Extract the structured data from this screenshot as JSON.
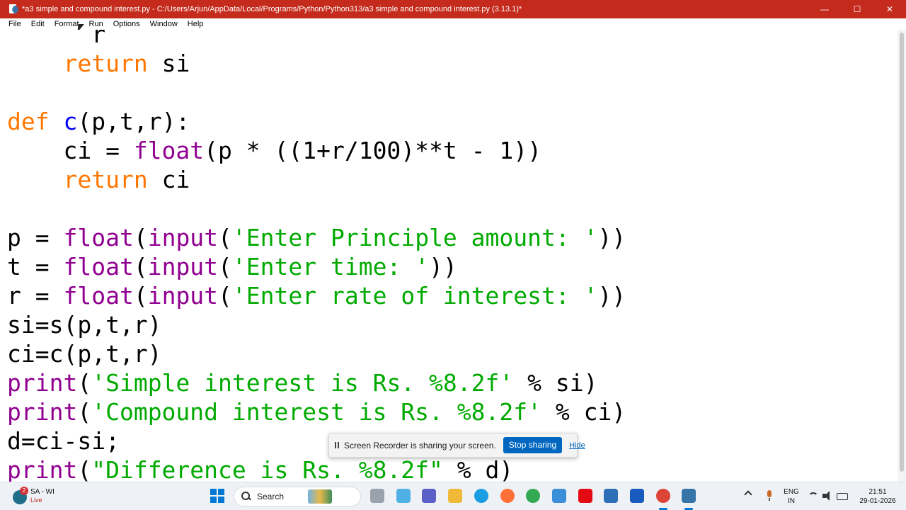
{
  "window": {
    "title": "*a3 simple and compound interest.py - C:/Users/Arjun/AppData/Local/Programs/Python/Python313/a3 simple and compound interest.py (3.13.1)*",
    "controls": {
      "minimize": "—",
      "maximize": "☐",
      "close": "✕"
    },
    "titlebar_color": "#c42b1c"
  },
  "menu": {
    "items": [
      "File",
      "Edit",
      "Format",
      "Run",
      "Options",
      "Window",
      "Help"
    ]
  },
  "editor": {
    "colors": {
      "keyword": "#ff7700",
      "definition": "#0000ff",
      "builtin": "#900090",
      "string": "#00aa00",
      "default": "#000000"
    },
    "lines": [
      {
        "kind": "partial",
        "text": "      r"
      },
      {
        "kind": "code",
        "text": "    return si"
      },
      {
        "kind": "blank",
        "text": ""
      },
      {
        "kind": "code",
        "text": "def c(p,t,r):"
      },
      {
        "kind": "code",
        "text": "    ci = float(p * ((1+r/100)**t - 1))"
      },
      {
        "kind": "code",
        "text": "    return ci"
      },
      {
        "kind": "blank",
        "text": ""
      },
      {
        "kind": "code",
        "text": "p = float(input('Enter Principle amount: '))"
      },
      {
        "kind": "code",
        "text": "t = float(input('Enter time: '))"
      },
      {
        "kind": "code",
        "text": "r = float(input('Enter rate of interest: '))"
      },
      {
        "kind": "code",
        "text": "si=s(p,t,r)"
      },
      {
        "kind": "code",
        "text": "ci=c(p,t,r)"
      },
      {
        "kind": "code",
        "text": "print('Simple interest is Rs. %8.2f' % si)"
      },
      {
        "kind": "code",
        "text": "print('Compound interest is Rs. %8.2f' % ci)"
      },
      {
        "kind": "code",
        "text": "d=ci-si;"
      },
      {
        "kind": "code",
        "text": "print(\"Difference is Rs. %8.2f\" % d)"
      }
    ]
  },
  "screen_share_toast": {
    "message": "Screen Recorder is sharing your screen.",
    "stop_label": "Stop sharing",
    "hide_label": "Hide"
  },
  "taskbar": {
    "weather": {
      "badge": "2",
      "title": "SA - WI",
      "subtitle": "Live"
    },
    "search_label": "Search",
    "apps": [
      {
        "name": "task-view",
        "color": "#9aa3ad"
      },
      {
        "name": "copilot",
        "color": "#4fb0e6"
      },
      {
        "name": "teams",
        "color": "#5b5fc7"
      },
      {
        "name": "file-explorer",
        "color": "#f0b93a"
      },
      {
        "name": "edge",
        "color": "#1b9de2"
      },
      {
        "name": "firefox",
        "color": "#ff7139"
      },
      {
        "name": "chrome",
        "color": "#34a853"
      },
      {
        "name": "microsoft-store",
        "color": "#3b8ed8"
      },
      {
        "name": "netflix",
        "color": "#e50914"
      },
      {
        "name": "screen-recorder",
        "color": "#2c6fb7"
      },
      {
        "name": "word",
        "color": "#185abd"
      },
      {
        "name": "chrome-profile",
        "color": "#db4437"
      },
      {
        "name": "idle",
        "color": "#3775a9"
      }
    ],
    "language": {
      "line1": "ENG",
      "line2": "IN"
    },
    "clock": {
      "time": "21:51",
      "date": "29-01-2026"
    }
  }
}
